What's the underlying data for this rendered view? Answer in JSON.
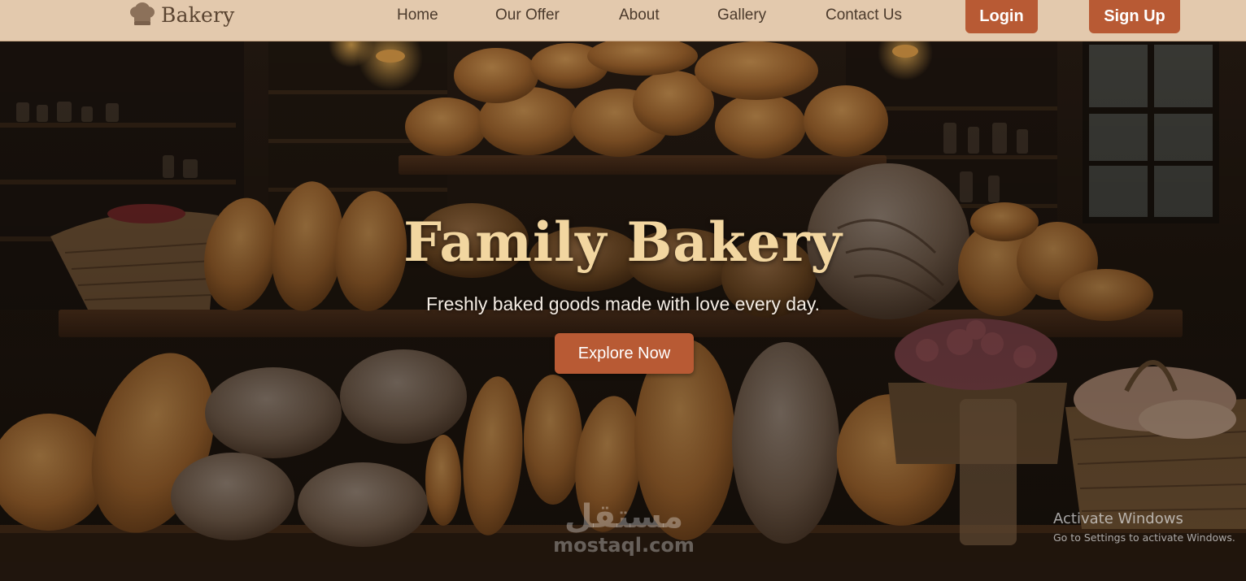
{
  "navbar": {
    "brand": "Bakery",
    "brand_icon": "chef-hat-icon",
    "links": [
      "Home",
      "Our Offer",
      "About",
      "Gallery",
      "Contact Us"
    ],
    "login_label": "Login",
    "signup_label": "Sign Up"
  },
  "hero": {
    "title": "Family Bakery",
    "subtitle": "Freshly baked goods made with love every day.",
    "cta_label": "Explore Now"
  },
  "watermark": {
    "arabic": "مستقل",
    "latin": "mostaql.com"
  },
  "os_overlay": {
    "title": "Activate Windows",
    "subtitle": "Go to Settings to activate Windows."
  },
  "colors": {
    "nav_background": "#e3c9ad",
    "accent": "#b85a34",
    "title_gold": "#f2d6a0",
    "nav_text": "#4b3a2c"
  }
}
